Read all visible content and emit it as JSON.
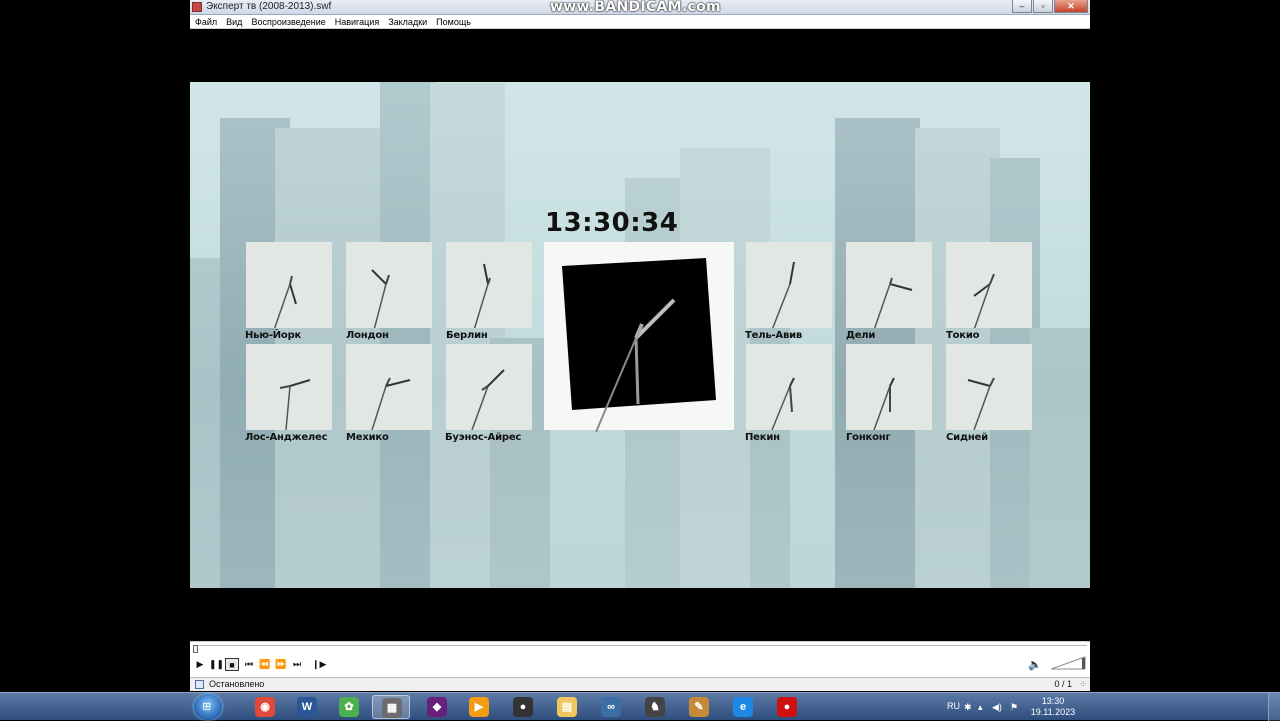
{
  "window": {
    "title": "Эксперт тв (2008-2013).swf",
    "watermark": "www.BANDICAM.com",
    "buttons": {
      "minimize": "‒",
      "maximize": "▫",
      "close": "✕"
    }
  },
  "menu": [
    "Файл",
    "Вид",
    "Воспроизведение",
    "Навигация",
    "Закладки",
    "Помощь"
  ],
  "screen": {
    "digital_time": "13:30:34",
    "cities": [
      "Нью-Йорк",
      "Лондон",
      "Берлин",
      "Тель-Авив",
      "Дели",
      "Токио",
      "Лос-Анджелес",
      "Мехико",
      "Буэнос-Айрес",
      "Пекин",
      "Гонконг",
      "Сидней"
    ]
  },
  "player": {
    "buttons": {
      "play": "▶",
      "pause": "❚❚",
      "stop": "■",
      "prev": "⏮",
      "rewind": "⏪",
      "forward": "⏩",
      "next": "⏭",
      "step": "❙▶"
    },
    "volume_icon": "🔈",
    "status": "Остановлено",
    "frames": "0 / 1",
    "grip": "⁘"
  },
  "taskbar": {
    "start_icon": "windows-logo-icon",
    "apps": [
      {
        "name": "chrome",
        "glyph": "◉",
        "color": "#e04a3b"
      },
      {
        "name": "word",
        "glyph": "W",
        "color": "#2b5797"
      },
      {
        "name": "paint-app",
        "glyph": "✿",
        "color": "#4caf50"
      },
      {
        "name": "video-editor",
        "glyph": "▦",
        "color": "#6b6b6b"
      },
      {
        "name": "visual-studio",
        "glyph": "◆",
        "color": "#68217a"
      },
      {
        "name": "media-player",
        "glyph": "▶",
        "color": "#f39c12"
      },
      {
        "name": "obs",
        "glyph": "●",
        "color": "#333333"
      },
      {
        "name": "file-explorer",
        "glyph": "▤",
        "color": "#f0c75e"
      },
      {
        "name": "binoculars",
        "glyph": "∞",
        "color": "#3a6ea5"
      },
      {
        "name": "app-wolf",
        "glyph": "♞",
        "color": "#444444"
      },
      {
        "name": "paint-palette",
        "glyph": "✎",
        "color": "#c48a3a"
      },
      {
        "name": "internet-explorer",
        "glyph": "e",
        "color": "#1e88e5"
      },
      {
        "name": "bandicam-record",
        "glyph": "●",
        "color": "#d01010"
      }
    ],
    "tray": {
      "lang": "RU",
      "time": "13:30",
      "date": "19.11.2023"
    }
  }
}
